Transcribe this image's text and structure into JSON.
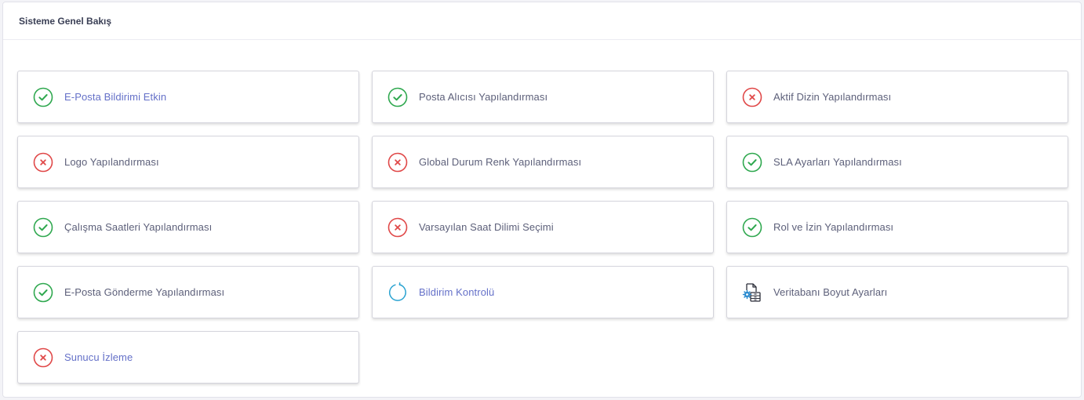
{
  "panel": {
    "title": "Sisteme Genel Bakış"
  },
  "colors": {
    "success": "#2fa84f",
    "error": "#e04848",
    "info": "#2ba3d1",
    "link_blue": "#6470c8",
    "text_gray": "#5d607a"
  },
  "cards": [
    {
      "label": "E-Posta Bildirimi Etkin",
      "status": "ok",
      "icon": "check-circle-icon"
    },
    {
      "label": "Posta Alıcısı Yapılandırması",
      "status": "ok",
      "icon": "check-circle-icon"
    },
    {
      "label": "Aktif Dizin Yapılandırması",
      "status": "error",
      "icon": "x-circle-icon"
    },
    {
      "label": "Logo Yapılandırması",
      "status": "error",
      "icon": "x-circle-icon"
    },
    {
      "label": "Global Durum Renk Yapılandırması",
      "status": "error",
      "icon": "x-circle-icon"
    },
    {
      "label": "SLA Ayarları Yapılandırması",
      "status": "ok",
      "icon": "check-circle-icon"
    },
    {
      "label": "Çalışma Saatleri Yapılandırması",
      "status": "ok",
      "icon": "check-circle-icon"
    },
    {
      "label": "Varsayılan Saat Dilimi Seçimi",
      "status": "error",
      "icon": "x-circle-icon"
    },
    {
      "label": "Rol ve İzin Yapılandırması",
      "status": "ok",
      "icon": "check-circle-icon"
    },
    {
      "label": "E-Posta Gönderme Yapılandırması",
      "status": "ok",
      "icon": "check-circle-icon"
    },
    {
      "label": "Bildirim Kontrolü",
      "status": "refresh",
      "icon": "refresh-icon"
    },
    {
      "label": "Veritabanı Boyut Ayarları",
      "status": "db",
      "icon": "database-settings-icon"
    },
    {
      "label": "Sunucu İzleme",
      "status": "error",
      "icon": "x-circle-icon"
    }
  ]
}
